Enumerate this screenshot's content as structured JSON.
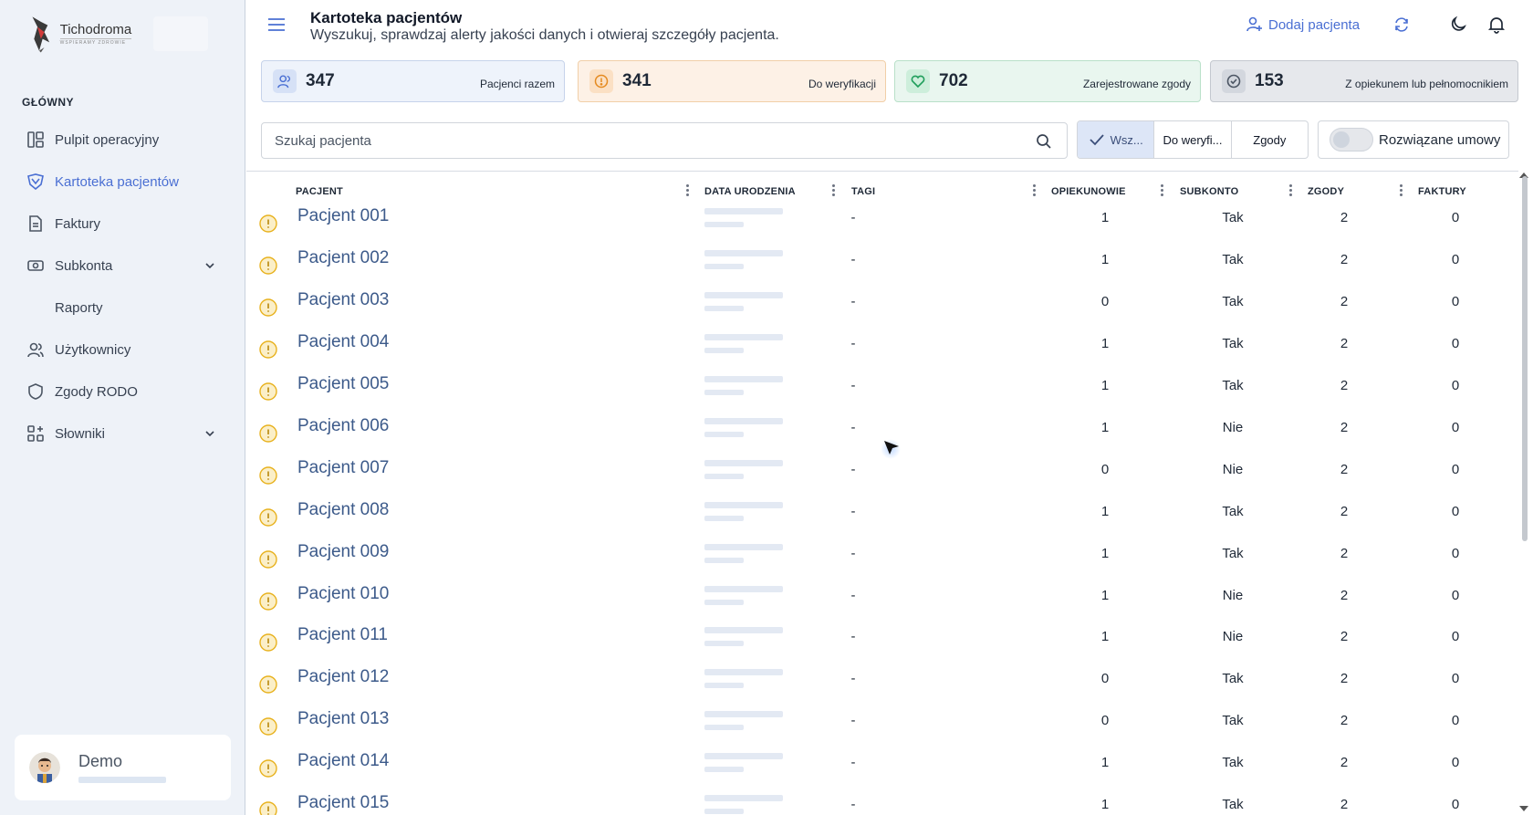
{
  "brand": {
    "name": "Tichodroma",
    "tagline": "WSPIERAMY ZDROWIE"
  },
  "sidebar": {
    "section": "GŁÓWNY",
    "items": [
      {
        "label": "Pulpit operacyjny",
        "icon": "dashboard-icon"
      },
      {
        "label": "Kartoteka pacjentów",
        "icon": "patients-icon",
        "active": true
      },
      {
        "label": "Faktury",
        "icon": "invoice-icon"
      },
      {
        "label": "Subkonta",
        "icon": "subaccount-icon",
        "expandable": true
      },
      {
        "label": "Raporty",
        "sub": true
      },
      {
        "label": "Użytkownicy",
        "icon": "users-icon"
      },
      {
        "label": "Zgody RODO",
        "icon": "shield-icon"
      },
      {
        "label": "Słowniki",
        "icon": "dictionary-icon",
        "expandable": true
      }
    ],
    "user": {
      "name": "Demo"
    }
  },
  "header": {
    "title": "Kartoteka pacjentów",
    "subtitle": "Wyszukuj, sprawdzaj alerty jakości danych i otwieraj szczegóły pacjenta.",
    "add_label": "Dodaj pacjenta"
  },
  "stats": [
    {
      "value": "347",
      "label": "Pacjenci razem"
    },
    {
      "value": "341",
      "label": "Do weryfikacji"
    },
    {
      "value": "702",
      "label": "Zarejestrowane zgody"
    },
    {
      "value": "153",
      "label": "Z opiekunem lub pełnomocnikiem"
    }
  ],
  "search": {
    "placeholder": "Szukaj pacjenta"
  },
  "filters": {
    "all": "Wsz...",
    "verify": "Do weryfi...",
    "consents": "Zgody"
  },
  "toggle": {
    "label": "Rozwiązane umowy"
  },
  "table": {
    "columns": [
      "PACJENT",
      "DATA URODZENIA",
      "TAGI",
      "OPIEKUNOWIE",
      "SUBKONTO",
      "ZGODY",
      "FAKTURY"
    ],
    "rows": [
      {
        "name": "Pacjent 001",
        "tags": "-",
        "guardians": "1",
        "subaccount": "Tak",
        "consents": "2",
        "invoices": "0"
      },
      {
        "name": "Pacjent 002",
        "tags": "-",
        "guardians": "1",
        "subaccount": "Tak",
        "consents": "2",
        "invoices": "0"
      },
      {
        "name": "Pacjent 003",
        "tags": "-",
        "guardians": "0",
        "subaccount": "Tak",
        "consents": "2",
        "invoices": "0"
      },
      {
        "name": "Pacjent 004",
        "tags": "-",
        "guardians": "1",
        "subaccount": "Tak",
        "consents": "2",
        "invoices": "0"
      },
      {
        "name": "Pacjent 005",
        "tags": "-",
        "guardians": "1",
        "subaccount": "Tak",
        "consents": "2",
        "invoices": "0"
      },
      {
        "name": "Pacjent 006",
        "tags": "-",
        "guardians": "1",
        "subaccount": "Nie",
        "consents": "2",
        "invoices": "0"
      },
      {
        "name": "Pacjent 007",
        "tags": "-",
        "guardians": "0",
        "subaccount": "Nie",
        "consents": "2",
        "invoices": "0"
      },
      {
        "name": "Pacjent 008",
        "tags": "-",
        "guardians": "1",
        "subaccount": "Tak",
        "consents": "2",
        "invoices": "0"
      },
      {
        "name": "Pacjent 009",
        "tags": "-",
        "guardians": "1",
        "subaccount": "Tak",
        "consents": "2",
        "invoices": "0"
      },
      {
        "name": "Pacjent 010",
        "tags": "-",
        "guardians": "1",
        "subaccount": "Nie",
        "consents": "2",
        "invoices": "0"
      },
      {
        "name": "Pacjent 011",
        "tags": "-",
        "guardians": "1",
        "subaccount": "Nie",
        "consents": "2",
        "invoices": "0"
      },
      {
        "name": "Pacjent 012",
        "tags": "-",
        "guardians": "0",
        "subaccount": "Tak",
        "consents": "2",
        "invoices": "0"
      },
      {
        "name": "Pacjent 013",
        "tags": "-",
        "guardians": "0",
        "subaccount": "Tak",
        "consents": "2",
        "invoices": "0"
      },
      {
        "name": "Pacjent 014",
        "tags": "-",
        "guardians": "1",
        "subaccount": "Tak",
        "consents": "2",
        "invoices": "0"
      },
      {
        "name": "Pacjent 015",
        "tags": "-",
        "guardians": "1",
        "subaccount": "Tak",
        "consents": "2",
        "invoices": "0"
      }
    ]
  },
  "colors": {
    "accent": "#4a6fd3",
    "warning": "#e8b21f",
    "sidebar_bg": "#eef2f8"
  }
}
